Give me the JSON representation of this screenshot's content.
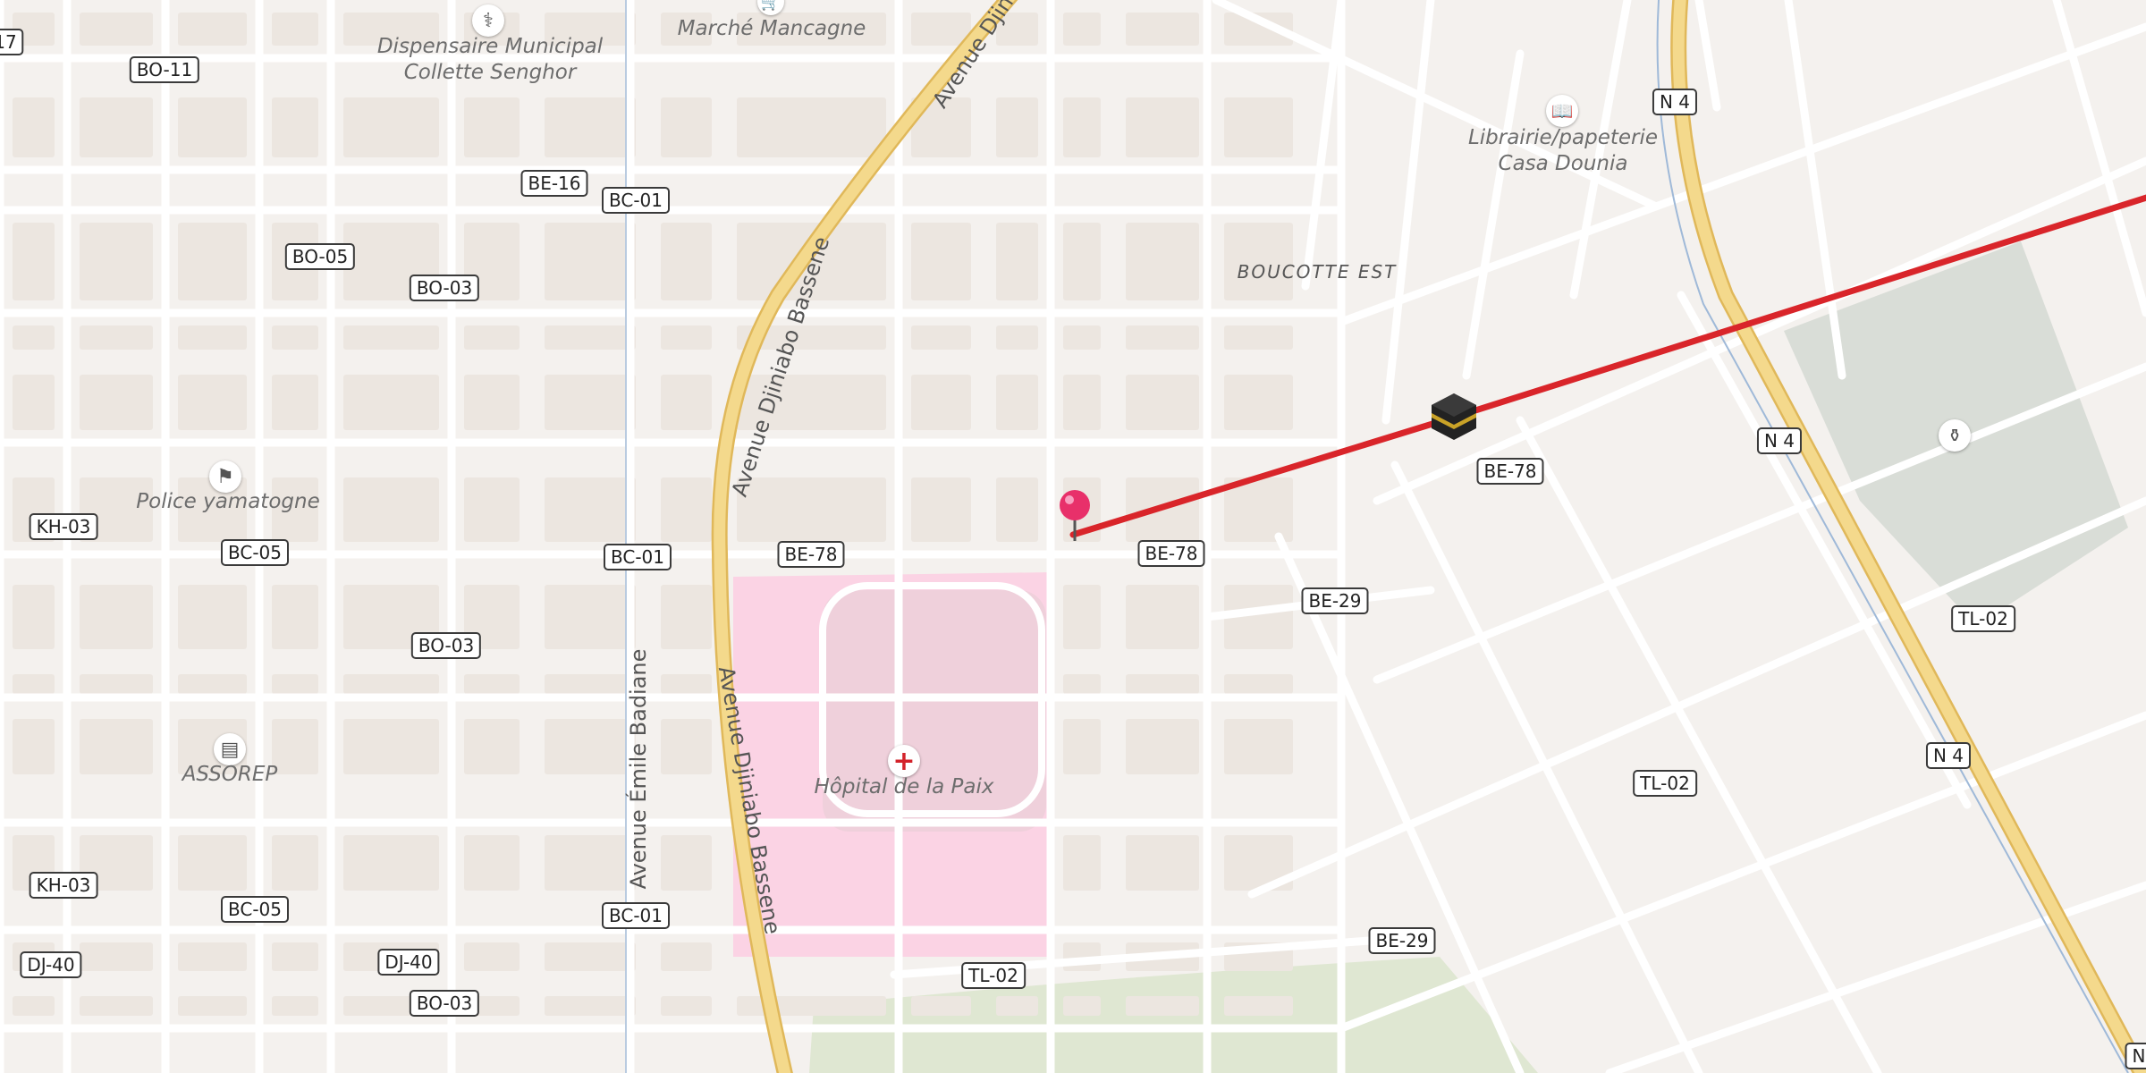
{
  "map": {
    "district": "BOUCOTTE EST",
    "road_shields": {
      "n4_top": "N 4",
      "n4_mid": "N 4",
      "n4_low": "N 4",
      "n_edge": "N",
      "bo11": "BO-11",
      "be16": "BE-16",
      "bc01_top": "BC-01",
      "bo05_top": "BO-05",
      "bo03_top": "BO-03",
      "be78_right": "BE-78",
      "be78_center": "BE-78",
      "be78_left": "BE-78",
      "bc01_mid": "BC-01",
      "bc05_top": "BC-05",
      "kh03_top": "KH-03",
      "be29_top": "BE-29",
      "bo03_mid": "BO-03",
      "tl02_right": "TL-02",
      "tl02_mid": "TL-02",
      "kh03_low": "KH-03",
      "bc05_low": "BC-05",
      "bc01_low": "BC-01",
      "dj40_left": "DJ-40",
      "dj40_right": "DJ-40",
      "be29_low": "BE-29",
      "tl02_bottom": "TL-02",
      "bo03_low": "BO-03",
      "edge_17": "17"
    },
    "pois": {
      "dispensaire": {
        "line1": "Dispensaire Municipal",
        "line2": "Collette Senghor",
        "icon": "stethoscope-icon"
      },
      "marche": {
        "label": "Marché Mancagne",
        "icon": "shopping-cart-icon"
      },
      "librairie": {
        "line1": "Librairie/papeterie",
        "line2": "Casa Dounia",
        "icon": "book-icon"
      },
      "police": {
        "label": "Police yamatogne",
        "icon": "police-icon"
      },
      "assorep": {
        "label": "ASSOREP",
        "icon": "office-icon"
      },
      "hopital": {
        "label": "Hôpital de la Paix",
        "icon": "hospital-cross-icon"
      },
      "cemetery": {
        "icon": "cemetery-icon"
      },
      "kaaba": {
        "icon": "kaaba-icon"
      },
      "pin": {
        "icon": "map-pin-icon"
      }
    },
    "streets": {
      "djiniabo_top": "Avenue Djini",
      "djiniabo_mid": "Avenue Djiniabo Bassene",
      "djiniabo_low": "Avenue Djiniabo Bassene",
      "emile": "Avenue Émile Badiane"
    },
    "colors": {
      "background": "#f4f1ee",
      "minor_road": "#ffffff",
      "major_road": "#f4d98c",
      "hospital_area": "#fbd3e4",
      "park": "#dfe7d2",
      "cemetery": "#d9ddd7",
      "qibla_line": "#d9252a",
      "pin": "#e8306a"
    }
  }
}
